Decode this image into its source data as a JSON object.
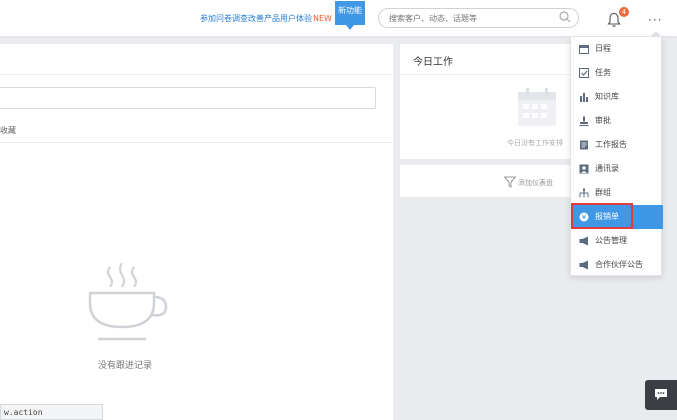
{
  "topbar": {
    "promo_text": "参加问卷调查改善产品用户体验",
    "promo_new": "NEW !",
    "new_feature_label": "新功能",
    "search_placeholder": "搜索客户、动态、话题等",
    "notification_count": "4",
    "more_label": "···"
  },
  "left_panel": {
    "tab_label": "收藏",
    "empty_text": "没有跟进记录"
  },
  "today_work": {
    "title": "今日工作",
    "empty_text": "今日没有工作安排"
  },
  "add_dashboard": {
    "label": "添加仪表盘"
  },
  "dropdown": {
    "items": [
      {
        "label": "日程",
        "icon": "calendar-icon"
      },
      {
        "label": "任务",
        "icon": "task-icon"
      },
      {
        "label": "知识库",
        "icon": "bar-chart-icon"
      },
      {
        "label": "审批",
        "icon": "stamp-icon"
      },
      {
        "label": "工作报告",
        "icon": "report-icon"
      },
      {
        "label": "通讯录",
        "icon": "contacts-icon"
      },
      {
        "label": "群组",
        "icon": "group-icon"
      },
      {
        "label": "报销单",
        "icon": "money-icon"
      },
      {
        "label": "公告管理",
        "icon": "megaphone-icon"
      },
      {
        "label": "合作伙伴公告",
        "icon": "megaphone-icon"
      }
    ],
    "active_item": "报销单"
  },
  "status_bar": {
    "url_text": "w.action"
  },
  "colors": {
    "accent": "#3f97e6",
    "badge": "#f06a3a",
    "highlight": "#e03a3a",
    "background": "#e9ebee"
  }
}
